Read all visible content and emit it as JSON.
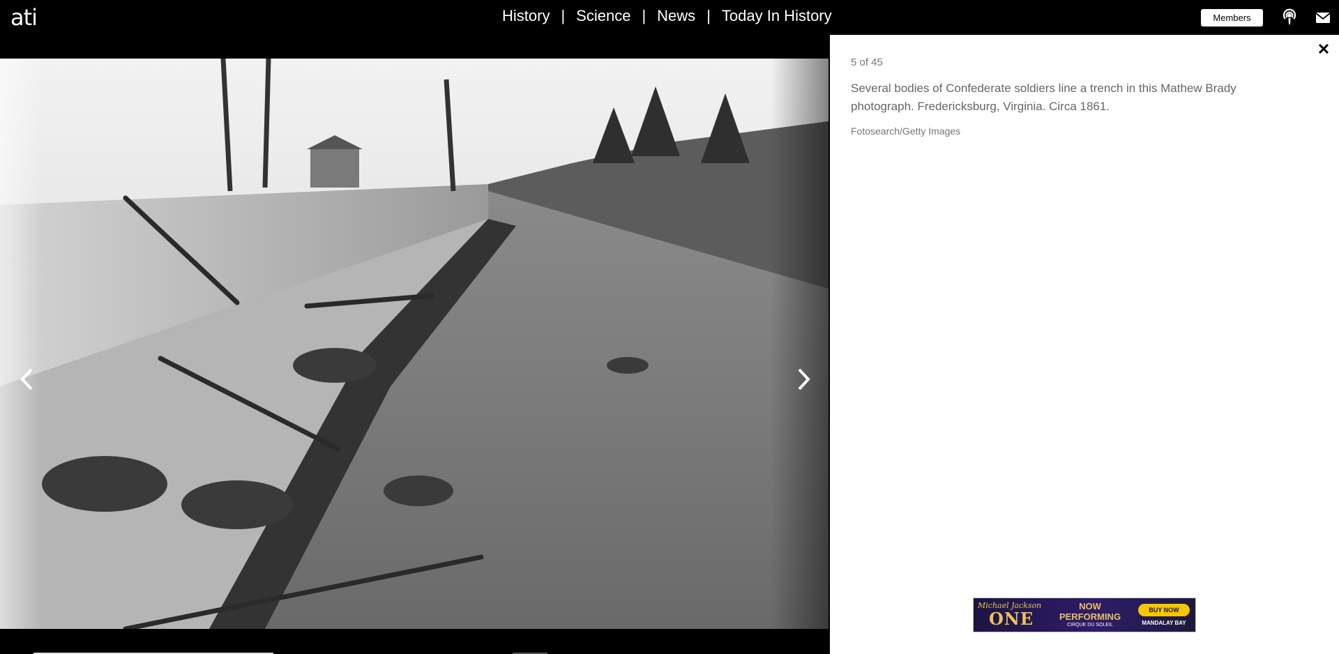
{
  "header": {
    "logo": "ati",
    "nav": [
      "History",
      "Science",
      "News",
      "Today In History"
    ],
    "members_label": "Members"
  },
  "gallery": {
    "counter": "5 of 45",
    "caption": "Several bodies of Confederate soldiers line a trench in this Mathew Brady photograph. Fredericksburg, Virginia. Circa 1861.",
    "credit": "Fotosearch/Getty Images"
  },
  "ad": {
    "brand_script": "Michael Jackson",
    "brand_title": "ONE",
    "headline": "NOW PERFORMING",
    "subline": "CIRQUE DU SOLEIL",
    "cta": "BUY NOW",
    "venue": "MANDALAY BAY"
  },
  "icons": [
    "podcast-icon",
    "mail-icon",
    "close-icon",
    "chevron-left-icon",
    "chevron-right-icon"
  ]
}
